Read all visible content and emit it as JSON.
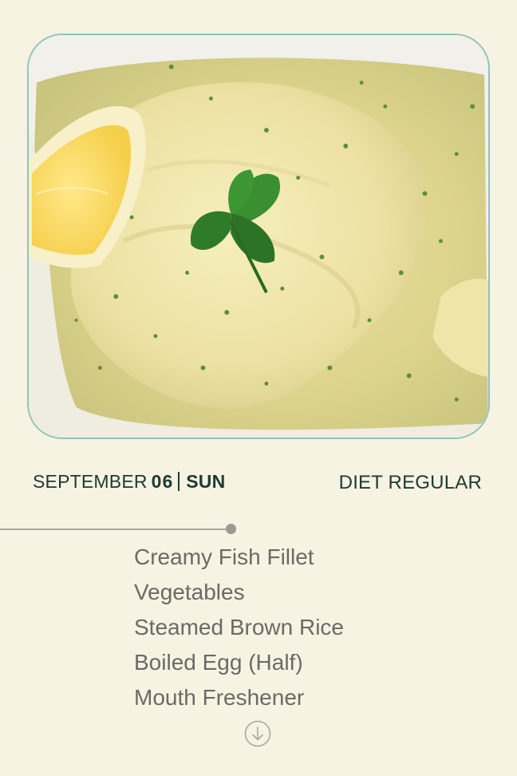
{
  "meal_image": {
    "icon": "creamy-fish-fillet-photo"
  },
  "date": {
    "month": "SEPTEMBER",
    "day": "06",
    "weekday": "SUN"
  },
  "diet": {
    "label": "DIET REGULAR"
  },
  "menu": {
    "items": [
      "Creamy Fish Fillet",
      "Vegetables",
      "Steamed Brown Rice",
      "Boiled Egg (Half)",
      "Mouth Freshener"
    ]
  },
  "expand": {
    "icon": "arrow-down-circle-icon"
  },
  "colors": {
    "background": "#f6f3e2",
    "text_dark": "#1e3a34",
    "text_menu": "#6a6a66",
    "card_border": "#8fc3bb"
  }
}
